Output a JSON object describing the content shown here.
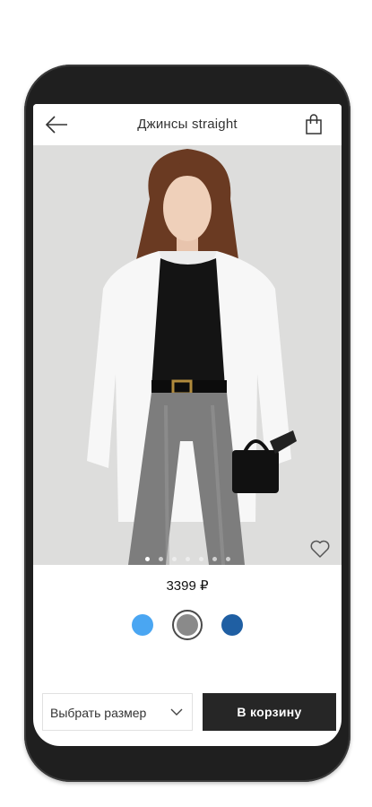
{
  "header": {
    "title": "Джинсы straight",
    "back_icon": "arrow-left-icon",
    "bag_icon": "shopping-bag-icon"
  },
  "gallery": {
    "image_count": 7,
    "active_index": 0,
    "favorite_icon": "heart-outline-icon"
  },
  "product": {
    "price": "3399 ₽"
  },
  "colors": [
    {
      "hex": "#4aa6f2",
      "selected": false
    },
    {
      "hex": "#8a8a8a",
      "selected": true
    },
    {
      "hex": "#1f5fa3",
      "selected": false
    }
  ],
  "actions": {
    "size_label": "Выбрать размер",
    "size_icon": "chevron-down-icon",
    "cart_label": "В корзину"
  }
}
